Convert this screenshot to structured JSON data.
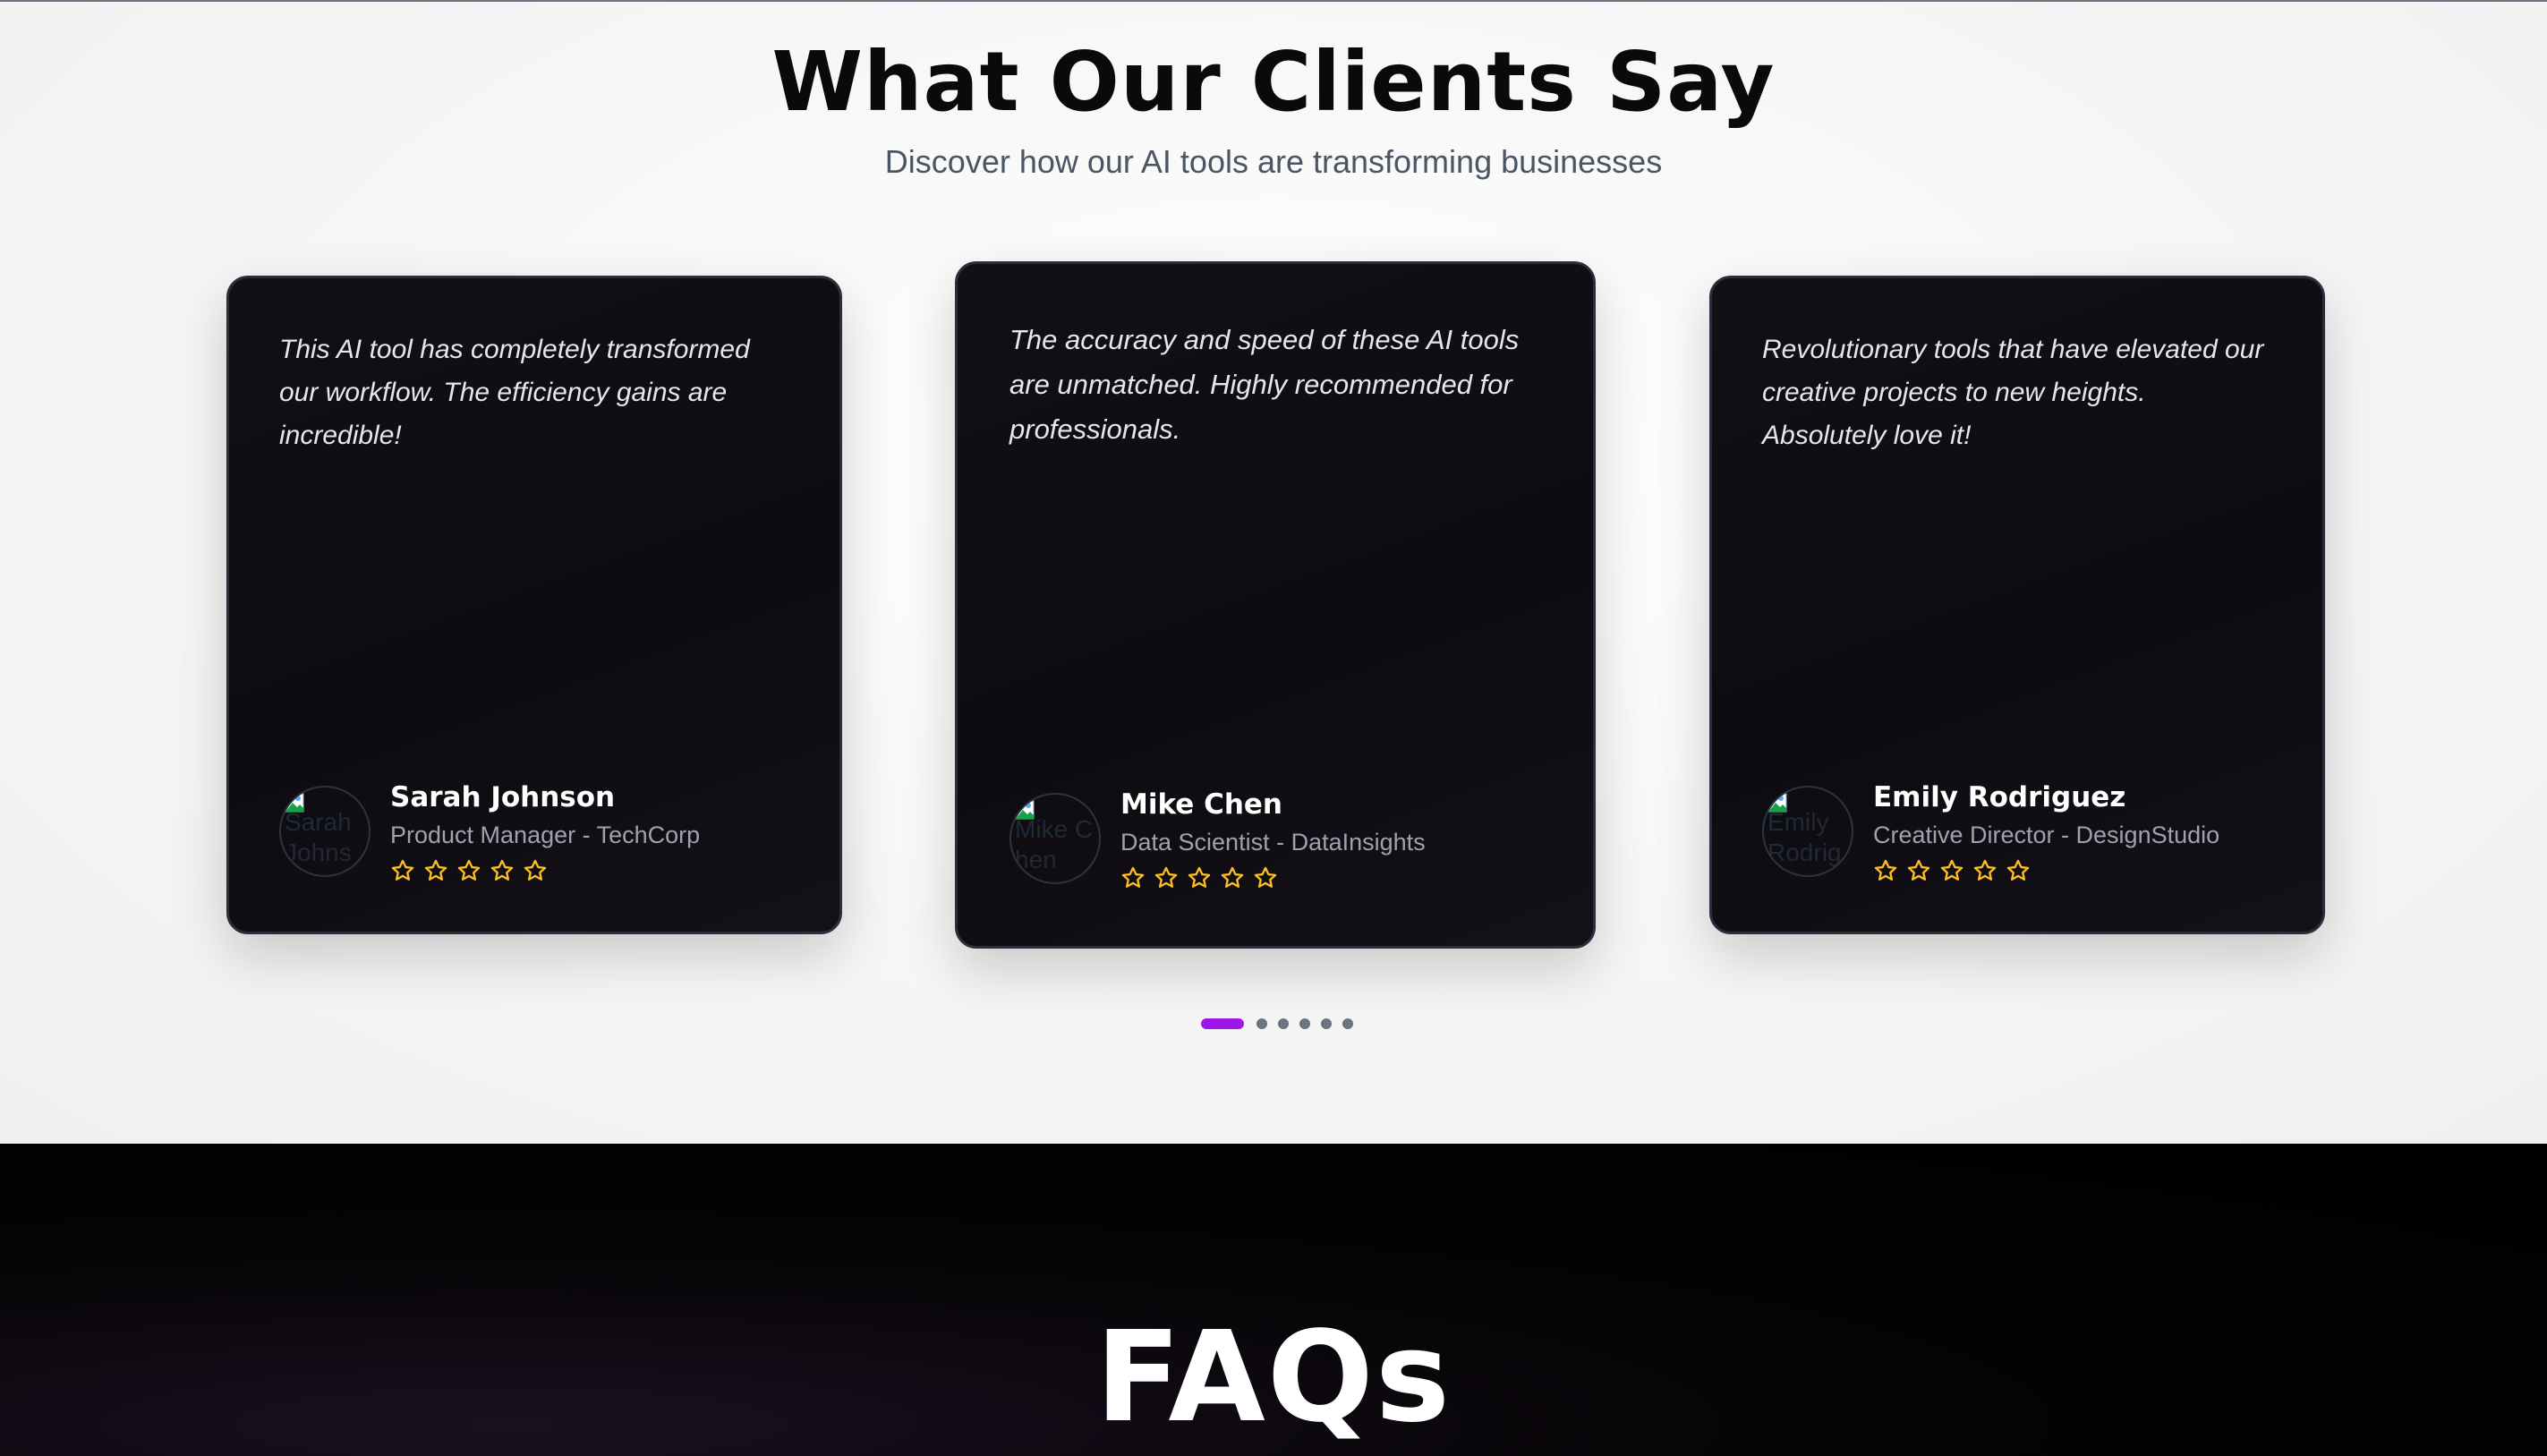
{
  "testimonials": {
    "title": "What Our Clients Say",
    "subtitle": "Discover how our AI tools are transforming businesses",
    "cards": [
      {
        "quote": "This AI tool has completely transformed our workflow. The efficiency gains are incredible!",
        "name": "Sarah Johnson",
        "role": "Product Manager - TechCorp",
        "avatar_alt": "Sarah Johnson",
        "rating": 5
      },
      {
        "quote": "The accuracy and speed of these AI tools are unmatched. Highly recommended for professionals.",
        "name": "Mike Chen",
        "role": "Data Scientist - DataInsights",
        "avatar_alt": "Mike Chen",
        "rating": 5
      },
      {
        "quote": "Revolutionary tools that have elevated our creative projects to new heights. Absolutely love it!",
        "name": "Emily Rodriguez",
        "role": "Creative Director - DesignStudio",
        "avatar_alt": "Emily Rodriguez",
        "rating": 5
      }
    ],
    "pagination": {
      "total": 6,
      "active": 0
    },
    "colors": {
      "star": "#fbbf24",
      "active_dot": "#9d17e8",
      "inactive_dot": "#6b7280"
    }
  },
  "faq": {
    "title": "FAQs"
  }
}
